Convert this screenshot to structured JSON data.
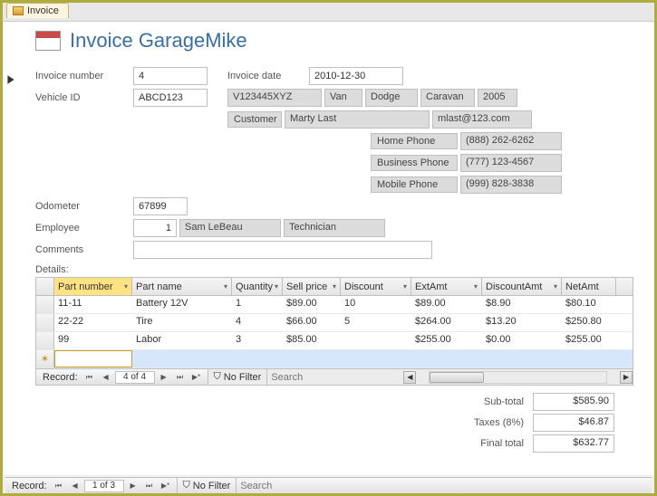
{
  "tab": {
    "label": "Invoice"
  },
  "header": {
    "title": "Invoice GarageMike"
  },
  "fields": {
    "invoice_number_lbl": "Invoice number",
    "invoice_number": "4",
    "invoice_date_lbl": "Invoice date",
    "invoice_date": "2010-12-30",
    "vehicle_id_lbl": "Vehicle ID",
    "vehicle_id": "ABCD123",
    "vin": "V123445XYZ",
    "body": "Van",
    "make": "Dodge",
    "model": "Caravan",
    "year": "2005",
    "customer_lbl": "Customer",
    "customer_name": "Marty Last",
    "customer_email": "mlast@123.com",
    "home_phone_lbl": "Home Phone",
    "home_phone": "(888) 262-6262",
    "business_phone_lbl": "Business Phone",
    "business_phone": "(777) 123-4567",
    "mobile_phone_lbl": "Mobile Phone",
    "mobile_phone": "(999) 828-3838",
    "odometer_lbl": "Odometer",
    "odometer": "67899",
    "employee_lbl": "Employee",
    "employee_id": "1",
    "employee_name": "Sam LeBeau",
    "employee_role": "Technician",
    "comments_lbl": "Comments",
    "comments": "",
    "details_lbl": "Details:"
  },
  "grid": {
    "headers": {
      "part_number": "Part number",
      "part_name": "Part name",
      "quantity": "Quantity",
      "sell_price": "Sell price",
      "discount": "Discount",
      "ext_amt": "ExtAmt",
      "discount_amt": "DiscountAmt",
      "net_amt": "NetAmt"
    },
    "rows": [
      {
        "pn": "11-11",
        "name": "Battery 12V",
        "qty": "1",
        "sp": "$89.00",
        "dc": "10",
        "ea": "$89.00",
        "da": "$8.90",
        "na": "$80.10"
      },
      {
        "pn": "22-22",
        "name": "Tire",
        "qty": "4",
        "sp": "$66.00",
        "dc": "5",
        "ea": "$264.00",
        "da": "$13.20",
        "na": "$250.80"
      },
      {
        "pn": "99",
        "name": "Labor",
        "qty": "3",
        "sp": "$85.00",
        "dc": "",
        "ea": "$255.00",
        "da": "$0.00",
        "na": "$255.00"
      }
    ]
  },
  "subnav": {
    "record_lbl": "Record:",
    "pos": "4 of 4",
    "nofilter": "No Filter",
    "search": "Search"
  },
  "totals": {
    "subtotal_lbl": "Sub-total",
    "subtotal": "$585.90",
    "taxes_lbl": "Taxes (8%)",
    "taxes": "$46.87",
    "final_lbl": "Final total",
    "final": "$632.77"
  },
  "mainnav": {
    "record_lbl": "Record:",
    "pos": "1 of 3",
    "nofilter": "No Filter",
    "search": "Search"
  }
}
